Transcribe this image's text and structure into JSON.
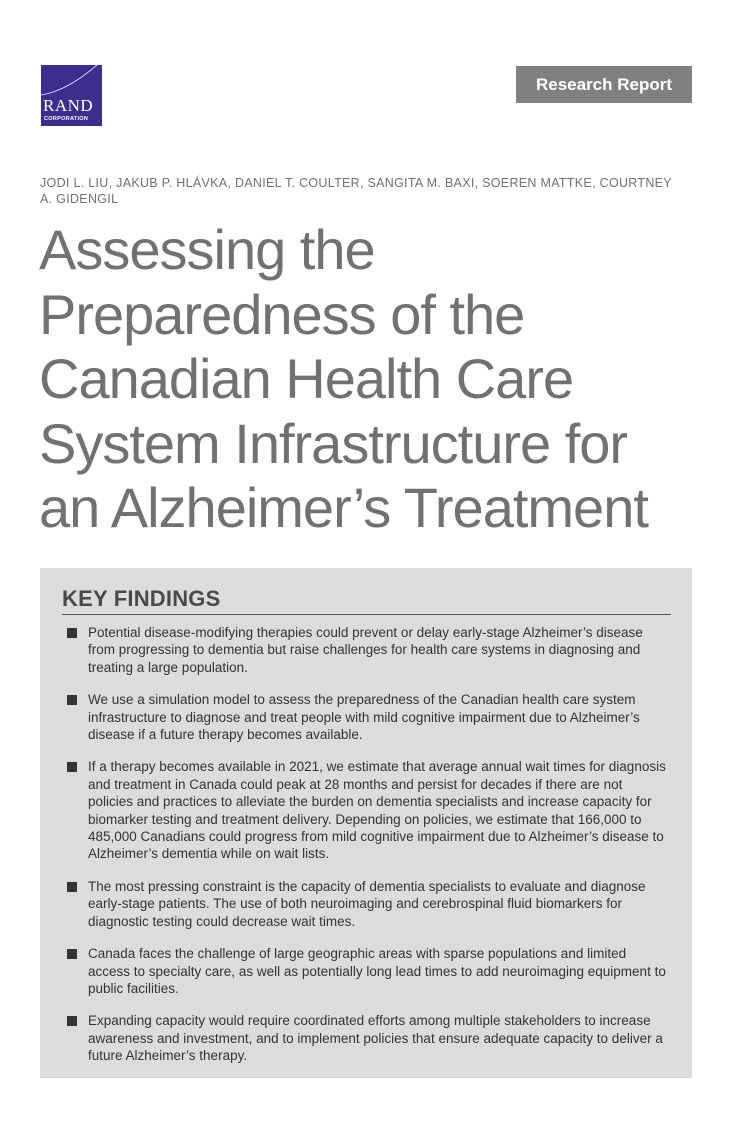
{
  "logo": {
    "name": "RAND",
    "subtitle": "CORPORATION",
    "color": "#3c2d8f"
  },
  "badge": "Research Report",
  "authors": "JODI L. LIU, JAKUB P. HLÁVKA, DANIEL T. COULTER, SANGITA M. BAXI, SOEREN MATTKE, COURTNEY A. GIDENGIL",
  "title": {
    "lines": [
      "Assessing the",
      "Preparedness of the",
      "Canadian Health Care",
      "System Infrastructure for",
      "an Alzheimer’s Treatment"
    ]
  },
  "key_findings": {
    "heading": "KEY FINDINGS",
    "items": [
      "Potential disease-modifying therapies could prevent or delay early-stage Alzheimer’s disease from progressing to dementia but raise challenges for health care systems in diagnosing and treating a large population.",
      "We use a simulation model to assess the preparedness of the Canadian health care system infrastructure to diagnose and treat people with mild cognitive impairment due to Alzheimer’s disease if a future therapy becomes available.",
      "If a therapy becomes available in 2021, we estimate that average annual wait times for diagnosis and treatment in Canada could peak at 28 months and persist for decades if there are not policies and practices to alleviate the burden on dementia specialists and increase capacity for biomarker testing and treatment delivery. Depending on policies, we estimate that 166,000 to 485,000 Canadians could progress from mild cognitive impairment due to Alzheimer’s disease to Alzheimer’s dementia while on wait lists.",
      "The most pressing constraint is the capacity of dementia specialists to evaluate and diag­nose early-stage patients. The use of both neuroimaging and cerebrospinal fluid biomarkers for diagnostic testing could decrease wait times.",
      "Canada faces the challenge of large geographic areas with sparse populations and limited access to specialty care, as well as potentially long lead times to add neuroimaging equip­ment to public facilities.",
      "Expanding capacity would require coordinated efforts among multiple stakeholders to increase awareness and investment, and to implement policies that ensure adequate capac­ity to deliver a future Alzheimer’s therapy."
    ]
  },
  "colors": {
    "badge_bg": "#808080",
    "findings_bg": "#dcdcdc",
    "title_text": "#717171"
  }
}
